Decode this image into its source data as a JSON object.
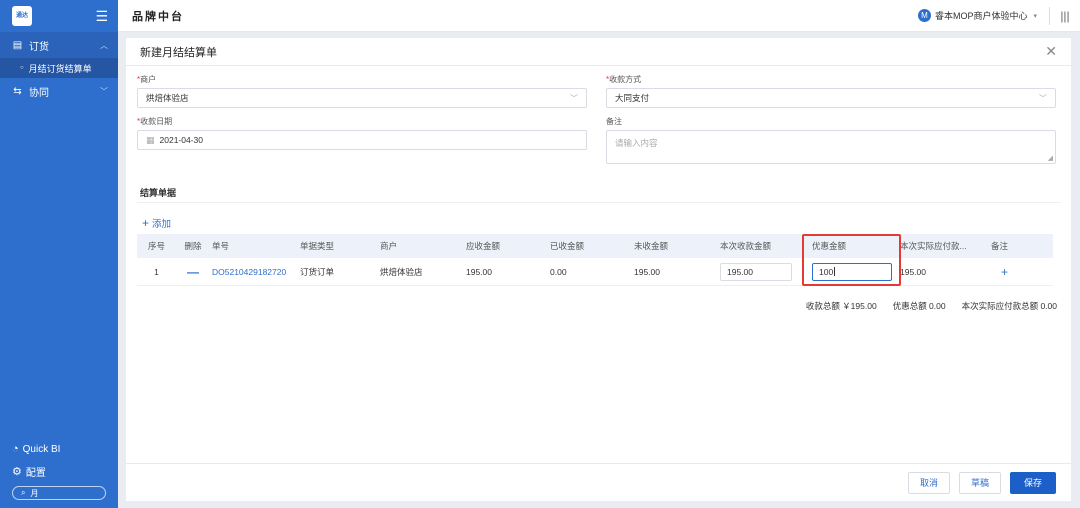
{
  "sidebar": {
    "logo_text": "通达\nSMART",
    "menu": [
      {
        "label": "订货",
        "icon": "document-icon"
      },
      {
        "label": "协同",
        "icon": "share-icon"
      }
    ],
    "submenu_item": "月结订货结算单",
    "bottom": {
      "quickbi": "Quick BI",
      "config": "配置",
      "search_value": "月"
    }
  },
  "topbar": {
    "title": "品牌中台",
    "org_avatar": "M",
    "org_name": "睿本MOP商户体验中心"
  },
  "modal": {
    "title": "新建月结结算单",
    "fields": {
      "merchant": {
        "label": "商户",
        "value": "烘焙体验店"
      },
      "payment_method": {
        "label": "收款方式",
        "value": "大同支付"
      },
      "receipt_date": {
        "label": "收款日期",
        "value": "2021-04-30"
      },
      "remark": {
        "label": "备注",
        "placeholder": "请输入内容"
      }
    },
    "section_title": "结算单据",
    "add_label": "添加",
    "table": {
      "headers": [
        "序号",
        "删除",
        "单号",
        "单据类型",
        "商户",
        "应收金额",
        "已收金额",
        "未收金额",
        "本次收款金额",
        "优惠金额",
        "本次实际应付款...",
        "备注"
      ],
      "rows": [
        {
          "index": "1",
          "order_no": "DO5210429182720",
          "doc_type": "订货订单",
          "merchant": "烘焙体验店",
          "receivable": "195.00",
          "received": "0.00",
          "unreceived": "195.00",
          "this_receipt": "195.00",
          "discount": "100",
          "actual_payable": "195.00"
        }
      ]
    },
    "summary": {
      "total_receipt": "收款总额 ￥195.00",
      "total_discount": "优惠总额 0.00",
      "total_actual": "本次实际应付款总额 0.00"
    },
    "buttons": {
      "cancel": "取消",
      "draft": "草稿",
      "save": "保存"
    }
  }
}
